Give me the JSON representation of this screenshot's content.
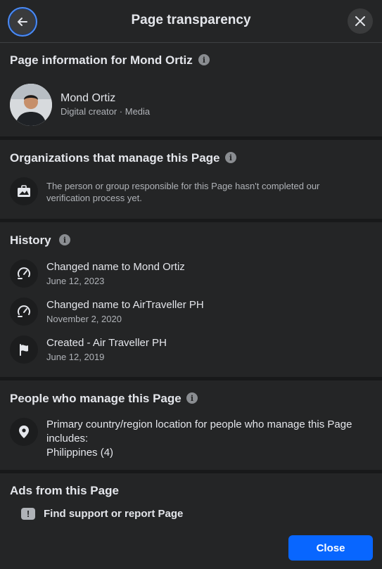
{
  "header": {
    "title": "Page transparency",
    "back_icon": "arrow-left-icon",
    "close_icon": "close-icon"
  },
  "page_info": {
    "title": "Page information for Mond Ortiz",
    "name": "Mond Ortiz",
    "category": "Digital creator · Media"
  },
  "organizations": {
    "title": "Organizations that manage this Page",
    "text": "The person or group responsible for this Page hasn't completed our verification process yet."
  },
  "history": {
    "title": "History",
    "items": [
      {
        "prefix": "Changed name to ",
        "value": "Mond Ortiz",
        "date": "June 12, 2023",
        "icon": "rename-icon"
      },
      {
        "prefix": "Changed name to ",
        "value": "AirTraveller PH",
        "date": "November 2, 2020",
        "icon": "rename-icon"
      },
      {
        "prefix": "Created - ",
        "value": "Air Traveller PH",
        "date": "June 12, 2019",
        "icon": "flag-icon"
      }
    ]
  },
  "people": {
    "title": "People who manage this Page",
    "line1": "Primary country/region location for people who manage this Page includes:",
    "line2": "Philippines (4)"
  },
  "ads": {
    "title": "Ads from this Page"
  },
  "report": {
    "label": "Find support or report Page"
  },
  "footer": {
    "close_label": "Close"
  },
  "colors": {
    "background": "#242526",
    "divider": "#18191a",
    "primary_button": "#0866ff",
    "focus_ring": "#4b8bf5"
  }
}
